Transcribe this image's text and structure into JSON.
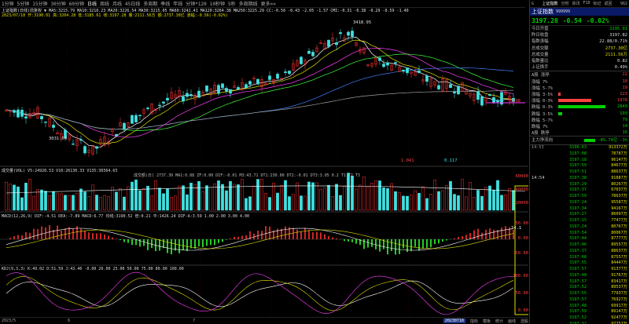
{
  "toolbar": {
    "items": [
      "1分钟",
      "5分钟",
      "15分钟",
      "30分钟",
      "60分钟",
      "日线",
      "周线",
      "月线",
      "45日线",
      "多周期",
      "季线",
      "年线",
      "分钟*120",
      "10秒钟",
      "5秒",
      "多周期线",
      "更多>>"
    ],
    "active_index": 5
  },
  "main_chart": {
    "legend": "上证指数(日线)前复权 ▼  MA5:3215.79  MA10:3210.23  MA20:3226.54  MA30:3215.05  MA60:3242.41  MA120:3264.38  MA250:3225.29  CC:-0.56  -0.43  -2.05  -1.57  CMI:-0.31  -0.38  -0.29  -0.59  -1.40",
    "info": "2023/07/18 开:3190.01  高:3204.28  低:3185.61  收:3197.28  量:2111.56万  额:2737.30亿  涨幅:-0.56(-0.02%)",
    "high_label": "3418.95",
    "low_label": "3031.54",
    "mid_label": "3198",
    "bottom_labels": [
      "1.041",
      "0.117"
    ]
  },
  "volume": {
    "legend": "成交量(VOL)  V5:24928.53  V10:26130.33  V135:36564.65",
    "legend2": "成交额(日)  2737.30  MA1:0.88  ZF:0.00  DIF:-0.01  M3:43.71  DT1:230.00  DT2:-0.01  DT3:3.05  0.2  T1  T2  T3",
    "axis": [
      "60000",
      "40000",
      "20000"
    ]
  },
  "macd": {
    "legend": "MACD(12,26,9)  DIF:-4.51  DEA:-7.89  MACD:6.77  均线:3190.52  倍:0.21  平:1426.24  DIF-A:3.59  1.00  2.00  3.00  4.00",
    "axis": [
      "50.00",
      "0.00",
      "-50.00"
    ],
    "level_label": "24.1"
  },
  "kdj": {
    "legend": "KDJ(9,3,3)  K:49.02  D:51.59  J:43.46  -0.00  20.00  25.00  50.00  75.00  80.00  100.00",
    "axis": [
      "100.00",
      "50.00",
      "0.00"
    ]
  },
  "bottom_bar": {
    "dates": [
      "2023/5",
      "6",
      "7"
    ],
    "current_date": "20230718",
    "tabs": [
      "指标",
      "模板",
      "统计",
      "画线",
      "选股"
    ]
  },
  "right_panel": {
    "top_left": "G",
    "top_right": "962",
    "top_menu": [
      "上证指数",
      "分时",
      "资讯",
      "F10",
      "标记",
      "返回"
    ],
    "index_name": "上证指数",
    "index_code": "999999",
    "price": "3197.28",
    "change": "-0.54",
    "change_pct": "-0.02%",
    "stats": [
      {
        "label": "今日开盘",
        "value": "3195.01",
        "color": "g"
      },
      {
        "label": "昨日收盘",
        "value": "3197.82",
        "color": "w"
      },
      {
        "label": "指数涨幅",
        "value": "22.88/0.71%",
        "color": "w"
      },
      {
        "label": "总成交额",
        "value": "2737.30亿",
        "color": "y"
      },
      {
        "label": "总成交量",
        "value": "2111.56万",
        "color": "y"
      },
      {
        "label": "指数量比",
        "value": "0.82",
        "color": "w"
      },
      {
        "label": "上证换手",
        "value": "0.49%",
        "color": "w"
      }
    ],
    "dist": [
      {
        "label": "A股 涨停",
        "value": "22",
        "color": "#ff4040",
        "width": 0
      },
      {
        "label": "涨幅 7%",
        "value": "10",
        "color": "#ff4040",
        "width": 0
      },
      {
        "label": "涨幅 5-7%",
        "value": "19",
        "color": "#ff4040",
        "width": 0
      },
      {
        "label": "涨幅 3-5%",
        "value": "123",
        "color": "#ff4040",
        "width": 3
      },
      {
        "label": "涨幅 0-3%",
        "value": "1978",
        "color": "#ff4040",
        "width": 42
      },
      {
        "label": "跌幅 0-3%",
        "value": "2849",
        "color": "#00d000",
        "width": 60
      },
      {
        "label": "跌幅 3-5%",
        "value": "193",
        "color": "#00d000",
        "width": 5
      },
      {
        "label": "跌幅 5-7%",
        "value": "79",
        "color": "#00d000",
        "width": 0
      },
      {
        "label": "跌幅 7%",
        "value": "14",
        "color": "#00d000",
        "width": 0
      },
      {
        "label": "A股 跌停",
        "value": "16",
        "color": "#00d000",
        "width": 0
      }
    ],
    "main_flow_label": "主力净流向",
    "main_flow_value": "-85.74亿",
    "main_flow_pct": "-3%",
    "ticks": [
      {
        "t": "14:53",
        "p": "3196.63",
        "v": "913372万"
      },
      {
        "t": "",
        "p": "3197.08",
        "v": "78787万"
      },
      {
        "t": "",
        "p": "3197.18",
        "v": "96147万"
      },
      {
        "t": "",
        "p": "3197.59",
        "v": "84677万"
      },
      {
        "t": "",
        "p": "3197.51",
        "v": "88637万"
      },
      {
        "t": "",
        "p": "3197.38",
        "v": "91887万"
      },
      {
        "t": "",
        "p": "3197.29",
        "v": "80267万"
      },
      {
        "t": "",
        "p": "3197.37",
        "v": "67037万"
      },
      {
        "t": "",
        "p": "3197.59",
        "v": "78637万"
      },
      {
        "t": "",
        "p": "3197.24",
        "v": "95587万"
      },
      {
        "t": "",
        "p": "3197.34",
        "v": "94167万"
      },
      {
        "t": "",
        "p": "3197.27",
        "v": "86097万"
      },
      {
        "t": "",
        "p": "3197.15",
        "v": "77477万"
      },
      {
        "t": "",
        "p": "3197.24",
        "v": "80767万"
      },
      {
        "t": "",
        "p": "3197.54",
        "v": "80067万"
      },
      {
        "t": "",
        "p": "3197.44",
        "v": "87777万"
      },
      {
        "t": "",
        "p": "3197.46",
        "v": "89557万"
      },
      {
        "t": "",
        "p": "3197.37",
        "v": "88637万"
      },
      {
        "t": "",
        "p": "3197.68",
        "v": "87557万"
      },
      {
        "t": "",
        "p": "3197.55",
        "v": "84447万"
      },
      {
        "t": "",
        "p": "3197.57",
        "v": "91377万"
      },
      {
        "t": "",
        "p": "3197.48",
        "v": "91767万"
      },
      {
        "t": "",
        "p": "3197.57",
        "v": "83417万"
      },
      {
        "t": "",
        "p": "3197.52",
        "v": "89537万"
      },
      {
        "t": "",
        "p": "3197.55",
        "v": "77937万"
      },
      {
        "t": "",
        "p": "3197.57",
        "v": "76927万"
      },
      {
        "t": "",
        "p": "3197.48",
        "v": "69917万"
      },
      {
        "t": "",
        "p": "3197.59",
        "v": "89147万"
      },
      {
        "t": "",
        "p": "3197.52",
        "v": "92477万"
      },
      {
        "t": "",
        "p": "3197.32",
        "v": "97757万"
      },
      {
        "t": "",
        "p": "3197.27",
        "v": "93337万"
      },
      {
        "t": "14:55",
        "p": "3197.28",
        "v": "1.08亿"
      }
    ],
    "side_time": "14:54"
  }
}
